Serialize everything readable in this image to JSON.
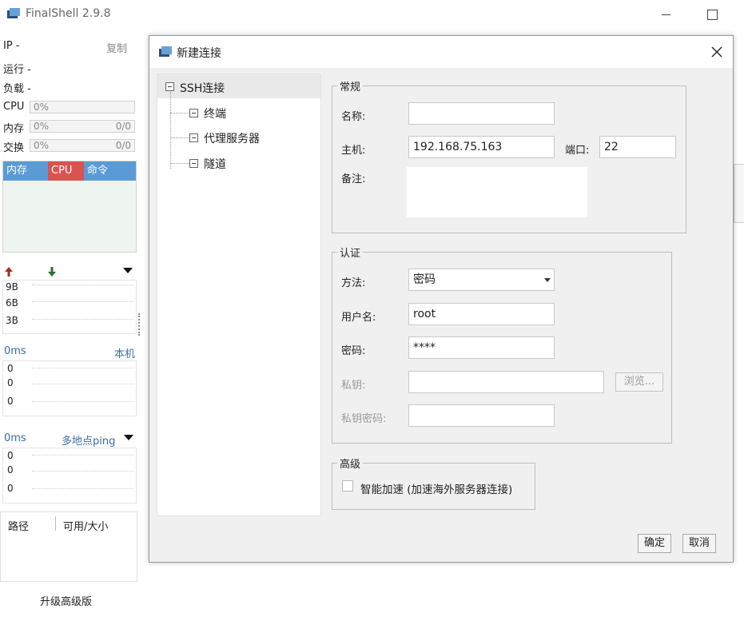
{
  "window": {
    "title": "FinalShell 2.9.8"
  },
  "sidebar": {
    "ip_label": "IP  -",
    "copy_label": "复制",
    "run_label": "运行 -",
    "load_label": "负载 -",
    "cpu": {
      "label": "CPU",
      "value": "0%"
    },
    "mem": {
      "label": "内存",
      "value": "0%",
      "ratio": "0/0"
    },
    "swap": {
      "label": "交换",
      "value": "0%",
      "ratio": "0/0"
    },
    "tabs": [
      "内存",
      "CPU",
      "命令"
    ],
    "net_axis": [
      "9B",
      "6B",
      "3B"
    ],
    "ping_local": {
      "latency": "0ms",
      "target": "本机",
      "axis": [
        "0",
        "0",
        "0"
      ]
    },
    "ping_multi": {
      "latency": "0ms",
      "target": "多地点ping",
      "axis": [
        "0",
        "0",
        "0"
      ]
    },
    "disk_headers": [
      "路径",
      "可用/大小"
    ],
    "upgrade_label": "升级高级版"
  },
  "dialog": {
    "title": "新建连接",
    "tree": {
      "root": "SSH连接",
      "children": [
        "终端",
        "代理服务器",
        "隧道"
      ]
    },
    "general": {
      "legend": "常规",
      "name_label": "名称:",
      "name_value": "",
      "host_label": "主机:",
      "host_value": "192.168.75.163",
      "port_label": "端口:",
      "port_value": "22",
      "note_label": "备注:",
      "note_value": ""
    },
    "auth": {
      "legend": "认证",
      "method_label": "方法:",
      "method_value": "密码",
      "user_label": "用户名:",
      "user_value": "root",
      "password_label": "密码:",
      "password_value": "****",
      "key_label": "私钥:",
      "key_value": "",
      "browse_label": "浏览...",
      "key_password_label": "私钥密码:",
      "key_password_value": ""
    },
    "advanced": {
      "legend": "高级",
      "accel_label": "智能加速 (加速海外服务器连接)",
      "accel_checked": false
    },
    "ok_label": "确定",
    "cancel_label": "取消"
  },
  "colors": {
    "tab_blue": "#5b9bd5",
    "tab_red": "#d9534f",
    "link_blue": "#3a6ea5",
    "upload_arrow": "#a3301e",
    "download_arrow": "#2f6b2f"
  }
}
